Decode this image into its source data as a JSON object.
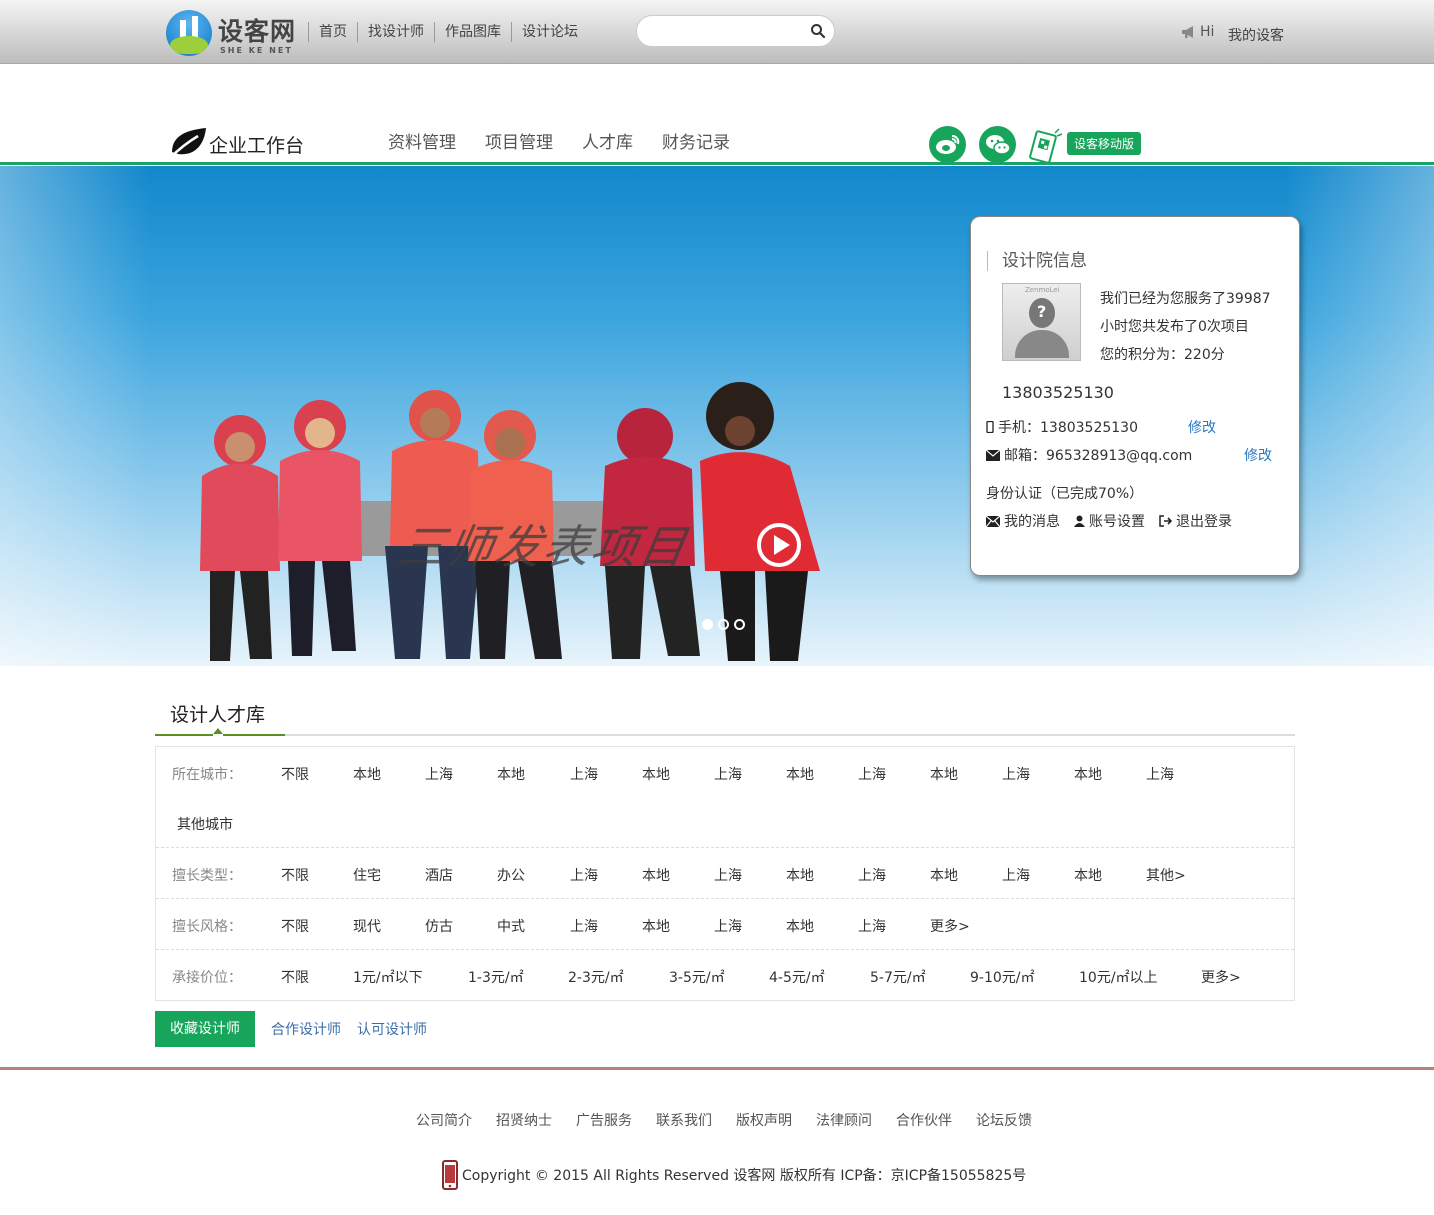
{
  "topbar": {
    "logo_text": "设客网",
    "logo_sub": "SHE KE NET",
    "nav": [
      "首页",
      "找设计师",
      "作品图库",
      "设计论坛"
    ],
    "search_placeholder": "",
    "hi": "Hi",
    "mine": "我的设客"
  },
  "header": {
    "workspace_title": "企业工作台",
    "nav": [
      "资料管理",
      "项目管理",
      "人才库",
      "财务记录"
    ],
    "mobile_button": "设客移动版"
  },
  "banner": {
    "calligraphy": "三师发表项目",
    "dots_total": 3,
    "active_dot": 1
  },
  "card": {
    "title": "设计院信息",
    "desc_line1": "我们已经为您服务了39987",
    "desc_line2": "小时您共发布了0次项目",
    "desc_line3": "您的积分为：220分",
    "phone_big": "13803525130",
    "mobile_label": "手机：13803525130",
    "mobile_edit": "修改",
    "email_label": "邮箱：965328913@qq.com",
    "email_edit": "修改",
    "identity": "身份认证（已完成70%）",
    "actions": [
      "我的消息",
      "账号设置",
      "退出登录"
    ],
    "avatar_caption": "ZenmoLei"
  },
  "talent": {
    "title": "设计人才库",
    "rows": [
      {
        "label": "所在城市：",
        "items": [
          "不限",
          "本地",
          "上海",
          "本地",
          "上海",
          "本地",
          "上海",
          "本地",
          "上海",
          "本地",
          "上海",
          "本地",
          "上海",
          "其他城市"
        ]
      },
      {
        "label": "擅长类型：",
        "items": [
          "不限",
          "住宅",
          "酒店",
          "办公",
          "上海",
          "本地",
          "上海",
          "本地",
          "上海",
          "本地",
          "上海",
          "本地",
          "其他>"
        ]
      },
      {
        "label": "擅长风格：",
        "items": [
          "不限",
          "现代",
          "仿古",
          "中式",
          "上海",
          "本地",
          "上海",
          "本地",
          "上海",
          "更多>"
        ]
      },
      {
        "label": "承接价位：",
        "items": [
          "不限",
          "1元/㎡以下",
          "1-3元/㎡",
          "2-3元/㎡",
          "3-5元/㎡",
          "4-5元/㎡",
          "5-7元/㎡",
          "9-10元/㎡",
          "10元/㎡以上",
          "更多>"
        ]
      }
    ],
    "tabs": [
      "收藏设计师",
      "合作设计师",
      "认可设计师"
    ]
  },
  "footer": {
    "nav": [
      "公司简介",
      "招贤纳士",
      "广告服务",
      "联系我们",
      "版权声明",
      "法律顾问",
      "合作伙伴",
      "论坛反馈"
    ],
    "copyright": "Copyright © 2015 All Rights Reserved 设客网 版权所有 ICP备：京ICP备15055825号"
  },
  "colors": {
    "accent": "#16a55b",
    "link": "#2a77c4",
    "footer_line": "#b88080"
  }
}
